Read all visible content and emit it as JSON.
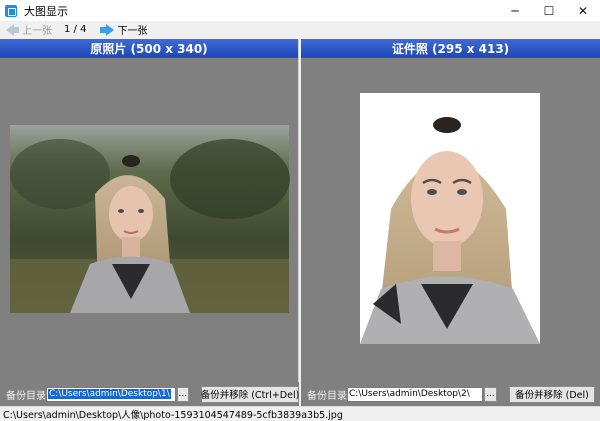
{
  "window": {
    "title": "大图显示",
    "icon": "app-photo-icon",
    "controls": {
      "minimize": "─",
      "maximize": "☐",
      "close": "✕"
    }
  },
  "toolbar": {
    "prev_label": "上一张",
    "next_label": "下一张",
    "page_counter": "1 / 4"
  },
  "left_panel": {
    "header": "原照片 (500 x 340)",
    "dir_label": "备份目录:",
    "dir_value": "C:\\Users\\admin\\Desktop\\1\\",
    "browse_label": "...",
    "action_label": "备份并移除 (Ctrl+Del)"
  },
  "right_panel": {
    "header": "证件照 (295 x 413)",
    "dir_label": "备份目录:",
    "dir_value": "C:\\Users\\admin\\Desktop\\2\\",
    "browse_label": "...",
    "action_label": "备份并移除 (Del)"
  },
  "status": {
    "path": "C:\\Users\\admin\\Desktop\\人像\\photo-1593104547489-5cfb3839a3b5.jpg"
  },
  "colors": {
    "panel_bg": "#808080",
    "header_blue": "#2a55c8",
    "selection": "#1767d3",
    "next_arrow": "#3aa0e8"
  }
}
